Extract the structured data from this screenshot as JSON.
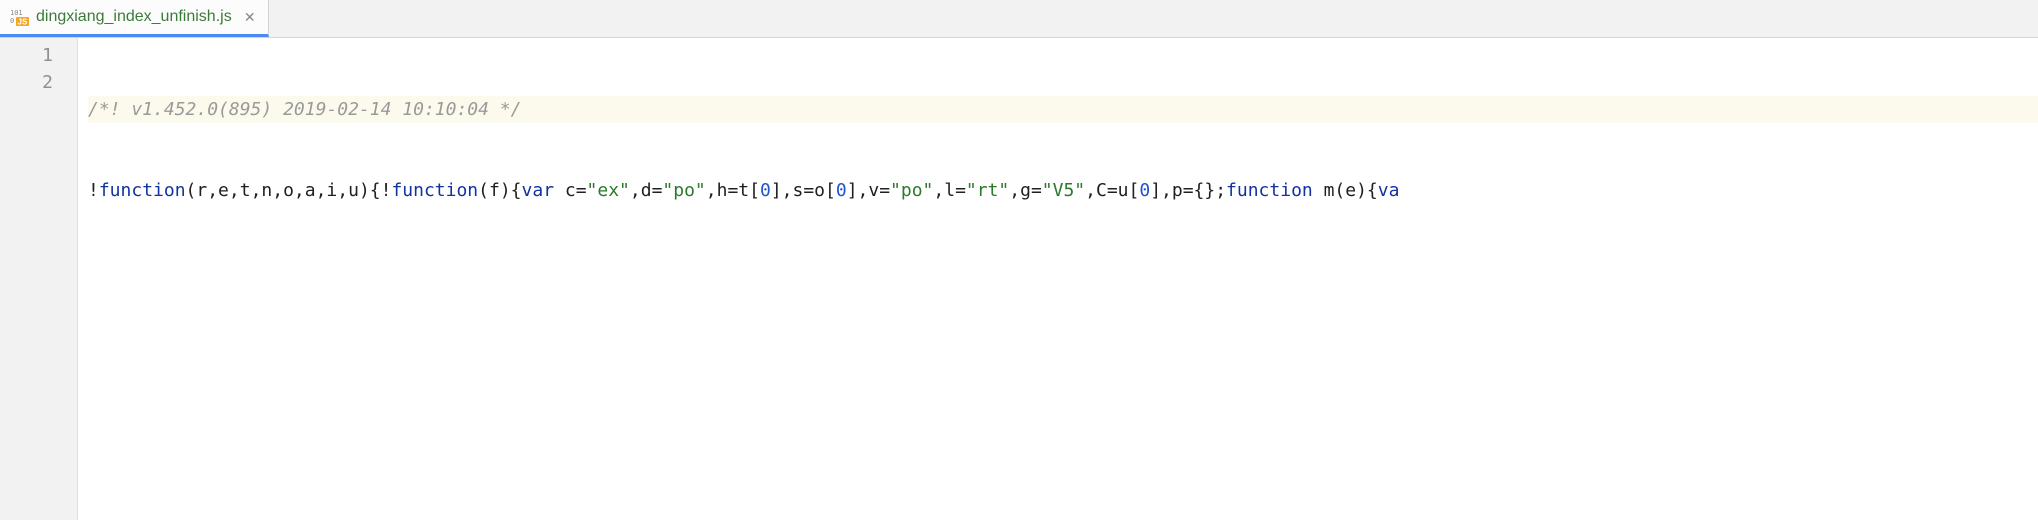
{
  "tab": {
    "filename": "dingxiang_index_unfinish.js",
    "icon_name": "js-file-icon"
  },
  "gutter": {
    "lines": [
      "1",
      "2"
    ]
  },
  "code": {
    "line1_comment": "/*! v1.452.0(895) 2019-02-14 10:10:04 */",
    "line2": {
      "t01": "!",
      "t02": "function",
      "t03": "(r,e,t,n,o,a,i,u){!",
      "t04": "function",
      "t05": "(f){",
      "t06": "var",
      "t07": " c=",
      "t08": "\"ex\"",
      "t09": ",d=",
      "t10": "\"po\"",
      "t11": ",h=t[",
      "t12": "0",
      "t13": "],s=o[",
      "t14": "0",
      "t15": "],v=",
      "t16": "\"po\"",
      "t17": ",l=",
      "t18": "\"rt\"",
      "t19": ",g=",
      "t20": "\"V5\"",
      "t21": ",C=u[",
      "t22": "0",
      "t23": "],p={};",
      "t24": "function",
      "t25": " m(e){",
      "t26": "va"
    }
  }
}
